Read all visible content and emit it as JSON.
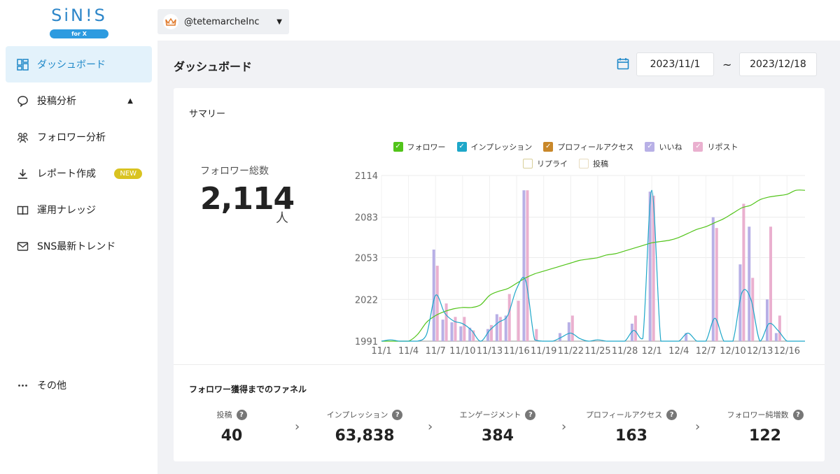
{
  "logo": {
    "name": "SiN!S",
    "badge": "for X"
  },
  "account": {
    "name": "@tetemarcheInc"
  },
  "sidebar": {
    "items": [
      {
        "label": "ダッシュボード",
        "icon": "dashboard-icon"
      },
      {
        "label": "投稿分析",
        "icon": "chat-bubble-icon"
      },
      {
        "label": "フォロワー分析",
        "icon": "users-icon"
      },
      {
        "label": "レポート作成",
        "icon": "download-icon",
        "badge": "NEW"
      },
      {
        "label": "運用ナレッジ",
        "icon": "book-icon"
      },
      {
        "label": "SNS最新トレンド",
        "icon": "mail-icon"
      },
      {
        "label": "その他",
        "icon": "more-icon"
      }
    ]
  },
  "page": {
    "title": "ダッシュボード",
    "date_from": "2023/11/1",
    "date_sep": "~",
    "date_to": "2023/12/18"
  },
  "summary": {
    "title": "サマリー",
    "followers_label": "フォロワー総数",
    "followers_value": "2,114",
    "followers_unit": "人"
  },
  "legend": [
    {
      "label": "フォロワー",
      "color": "#52c41a",
      "checked": true
    },
    {
      "label": "インプレッション",
      "color": "#1ea7c9",
      "checked": true
    },
    {
      "label": "プロフィールアクセス",
      "color": "#c9882a",
      "checked": true
    },
    {
      "label": "いいね",
      "color": "#b8b0e6",
      "checked": true
    },
    {
      "label": "リポスト",
      "color": "#eab0cf",
      "checked": true
    },
    {
      "label": "リプライ",
      "color": "#d8cf9a",
      "checked": false
    },
    {
      "label": "投稿",
      "color": "#e8dcc0",
      "checked": false
    }
  ],
  "chart_data": {
    "type": "bar",
    "y_ticks": [
      "2114",
      "2083",
      "2053",
      "2022",
      "1991"
    ],
    "ylim": [
      1991,
      2114
    ],
    "x_tick_labels": [
      "11/1",
      "11/4",
      "11/7",
      "11/10",
      "11/13",
      "11/16",
      "11/19",
      "11/22",
      "11/25",
      "11/28",
      "12/1",
      "12/4",
      "12/7",
      "12/10",
      "12/13",
      "12/16"
    ],
    "x": [
      "11/1",
      "11/2",
      "11/3",
      "11/4",
      "11/5",
      "11/6",
      "11/7",
      "11/8",
      "11/9",
      "11/10",
      "11/11",
      "11/12",
      "11/13",
      "11/14",
      "11/15",
      "11/16",
      "11/17",
      "11/18",
      "11/19",
      "11/20",
      "11/21",
      "11/22",
      "11/23",
      "11/24",
      "11/25",
      "11/26",
      "11/27",
      "11/28",
      "11/29",
      "11/30",
      "12/1",
      "12/2",
      "12/3",
      "12/4",
      "12/5",
      "12/6",
      "12/7",
      "12/8",
      "12/9",
      "12/10",
      "12/11",
      "12/12",
      "12/13",
      "12/14",
      "12/15",
      "12/16",
      "12/17",
      "12/18"
    ],
    "series": [
      {
        "name": "フォロワー",
        "type": "line",
        "color": "#52c41a",
        "values": [
          1991,
          1991,
          1991,
          1991,
          1996,
          2005,
          2010,
          2013,
          2015,
          2016,
          2016,
          2018,
          2025,
          2028,
          2030,
          2034,
          2038,
          2041,
          2043,
          2045,
          2047,
          2049,
          2051,
          2052,
          2053,
          2055,
          2056,
          2058,
          2060,
          2062,
          2064,
          2065,
          2066,
          2068,
          2071,
          2074,
          2076,
          2079,
          2082,
          2086,
          2090,
          2092,
          2096,
          2098,
          2099,
          2100,
          2103,
          2103
        ]
      },
      {
        "name": "インプレッション",
        "type": "line",
        "color": "#1ea7c9",
        "values": [
          1991,
          1992,
          1991,
          1991,
          1991,
          1996,
          2025,
          2012,
          2006,
          2004,
          1999,
          1991,
          1999,
          2005,
          2010,
          2030,
          2036,
          1992,
          1991,
          1991,
          1994,
          1997,
          1993,
          1991,
          1992,
          1991,
          1991,
          1991,
          1999,
          1993,
          2103,
          1991,
          1991,
          1991,
          1997,
          1991,
          1991,
          2008,
          1991,
          1991,
          2027,
          2022,
          1991,
          2004,
          1999,
          1991,
          1991,
          1991
        ]
      },
      {
        "name": "いいね",
        "type": "bar",
        "color": "#b8b0e6",
        "values": [
          1991,
          1991,
          1991,
          1991,
          1991,
          1991,
          2059,
          2007,
          2005,
          2002,
          2001,
          1991,
          2000,
          2011,
          2010,
          1991,
          2103,
          1991,
          1991,
          1991,
          1997,
          2005,
          1991,
          1991,
          1991,
          1991,
          1991,
          1991,
          2004,
          1991,
          2102,
          1991,
          1991,
          1991,
          1997,
          1991,
          1991,
          2083,
          1991,
          1991,
          2048,
          2076,
          1991,
          2022,
          1997,
          1991,
          1991,
          1991
        ]
      },
      {
        "name": "リポスト",
        "type": "bar",
        "color": "#eab0cf",
        "values": [
          1991,
          1991,
          1991,
          1991,
          1991,
          1991,
          2047,
          2019,
          2009,
          2009,
          1999,
          1991,
          2003,
          2009,
          2026,
          2021,
          2103,
          2000,
          1991,
          1991,
          1991,
          2010,
          1991,
          1991,
          1991,
          1991,
          1991,
          1991,
          2010,
          1991,
          2099,
          1991,
          1991,
          1991,
          1991,
          1991,
          1991,
          2075,
          1991,
          1991,
          2093,
          2038,
          1991,
          2076,
          2010,
          1991,
          1991,
          1991
        ]
      }
    ]
  },
  "funnel": {
    "title": "フォロワー獲得までのファネル",
    "steps": [
      {
        "label": "投稿",
        "value": "40"
      },
      {
        "label": "インプレッション",
        "value": "63,838"
      },
      {
        "label": "エンゲージメント",
        "value": "384"
      },
      {
        "label": "プロフィールアクセス",
        "value": "163"
      },
      {
        "label": "フォロワー純増数",
        "value": "122"
      }
    ],
    "help_glyph": "?",
    "arrow_glyph": "›"
  }
}
